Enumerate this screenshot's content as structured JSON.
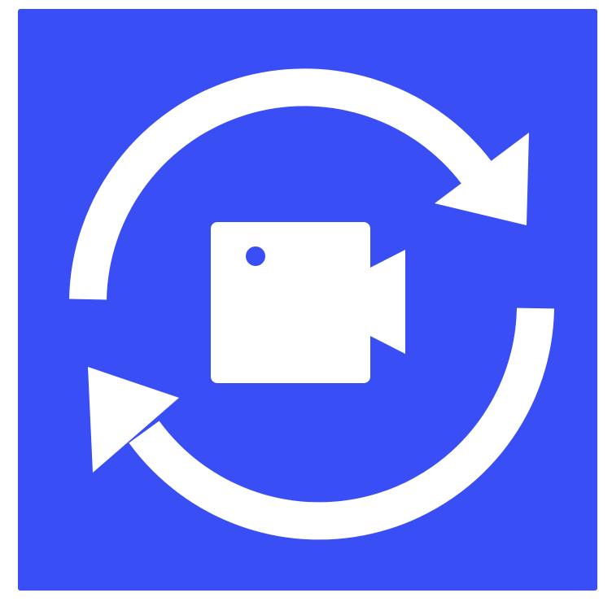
{
  "app_icon": {
    "icon": "video-convert-icon",
    "background_color": "#3a4ef5",
    "foreground_color": "#ffffff",
    "glyphs": {
      "arrows": "refresh-arrows-icon",
      "camera": "video-camera-icon"
    }
  }
}
